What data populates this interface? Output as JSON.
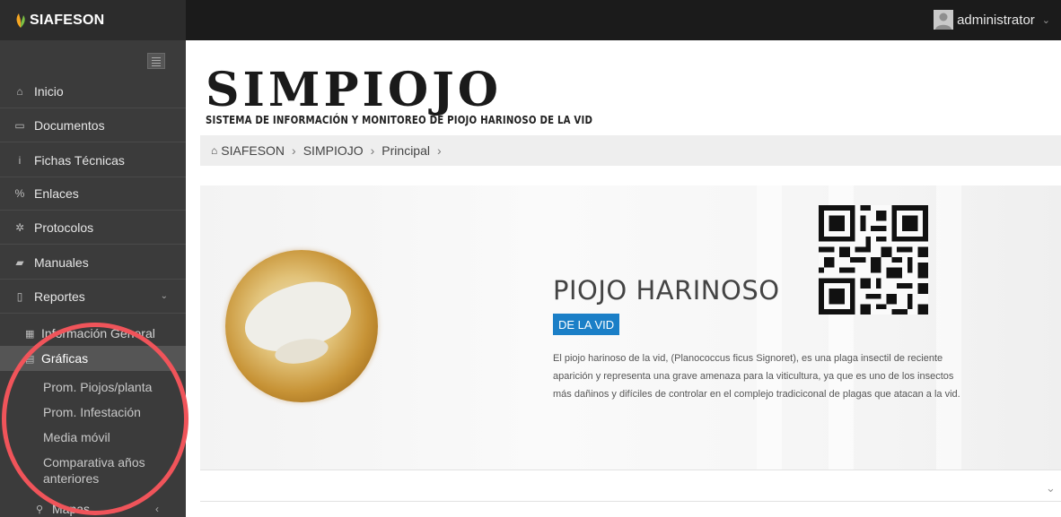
{
  "brand": {
    "name": "SIAFESON"
  },
  "user": {
    "name": "administrator",
    "chevron": "⌄"
  },
  "sidebar": {
    "items": [
      {
        "label": "Inicio",
        "icon": "home-icon",
        "glyph": "⌂"
      },
      {
        "label": "Documentos",
        "icon": "folder-icon",
        "glyph": "▭"
      },
      {
        "label": "Fichas Técnicas",
        "icon": "info-icon",
        "glyph": "i"
      },
      {
        "label": "Enlaces",
        "icon": "link-icon",
        "glyph": "%"
      },
      {
        "label": "Protocolos",
        "icon": "gear-icon",
        "glyph": "✲"
      },
      {
        "label": "Manuales",
        "icon": "book-icon",
        "glyph": "▰"
      },
      {
        "label": "Reportes",
        "icon": "file-icon",
        "glyph": "▯",
        "caret": "⌄"
      }
    ],
    "sub_items": [
      {
        "label": "Información General",
        "icon": "table-icon",
        "glyph": "▦"
      },
      {
        "label": "Gráficas",
        "icon": "chart-icon",
        "glyph": "▤"
      }
    ],
    "chart_items": [
      {
        "label": "Prom. Piojos/planta"
      },
      {
        "label": "Prom. Infestación"
      },
      {
        "label": "Media móvil"
      },
      {
        "label": "Comparativa años anteriores"
      }
    ],
    "maps": {
      "label": "Mapas",
      "icon": "map-marker-icon",
      "glyph": "⚲",
      "caret": "‹"
    }
  },
  "header": {
    "title": "SIMPIOJO",
    "subtitle": "SISTEMA DE INFORMACIÓN Y MONITOREO DE PIOJO HARINOSO DE LA VID"
  },
  "breadcrumb": {
    "items": [
      "SIAFESON",
      "SIMPIOJO",
      "Principal"
    ],
    "separator": "›"
  },
  "hero": {
    "title": "PIOJO HARINOSO",
    "badge": "DE LA VID",
    "description": "El piojo harinoso de la vid, (Planococcus ficus Signoret), es una plaga insectil de reciente aparición y representa una grave amenaza para la viticultura, ya que es uno de los insectos más dañinos y difíciles de controlar en el complejo tradiciconal de plagas que atacan a la vid."
  },
  "colors": {
    "topbar": "#1b1b1b",
    "sidebar": "#3b3b3b",
    "accent_blue": "#1b7fc7",
    "highlight_circle": "#f0545a"
  }
}
